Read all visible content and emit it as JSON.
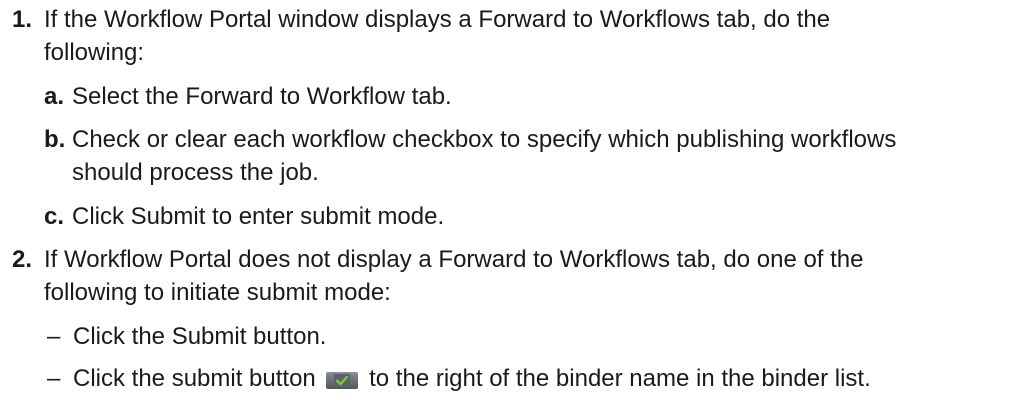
{
  "steps": [
    {
      "number": "1.",
      "lines": [
        "If the Workflow Portal window displays a Forward to Workflows tab, do the",
        "following:"
      ],
      "substeps": [
        {
          "letter": "a.",
          "lines": [
            "Select the Forward to Workflow tab."
          ]
        },
        {
          "letter": "b.",
          "lines": [
            "Check or clear each workflow checkbox to specify which publishing workflows",
            "should process the job."
          ]
        },
        {
          "letter": "c.",
          "lines": [
            "Click Submit to enter submit mode."
          ]
        }
      ]
    },
    {
      "number": "2.",
      "lines": [
        "If Workflow Portal does not display a Forward to Workflows tab, do one of the",
        "following to initiate submit mode:"
      ],
      "bullets": [
        {
          "dash": "–",
          "text": "Click the Submit button."
        },
        {
          "dash": "–",
          "text_before_icon": "Click the submit button",
          "icon": "submit-checkmark-icon",
          "text_after_icon": "to the right of the binder name in the binder list."
        }
      ]
    }
  ],
  "colors": {
    "text": "#1a1a1a",
    "icon_bg_top": "#8a8f96",
    "icon_bg_bottom": "#4f555c",
    "icon_check": "#7cc63a"
  }
}
